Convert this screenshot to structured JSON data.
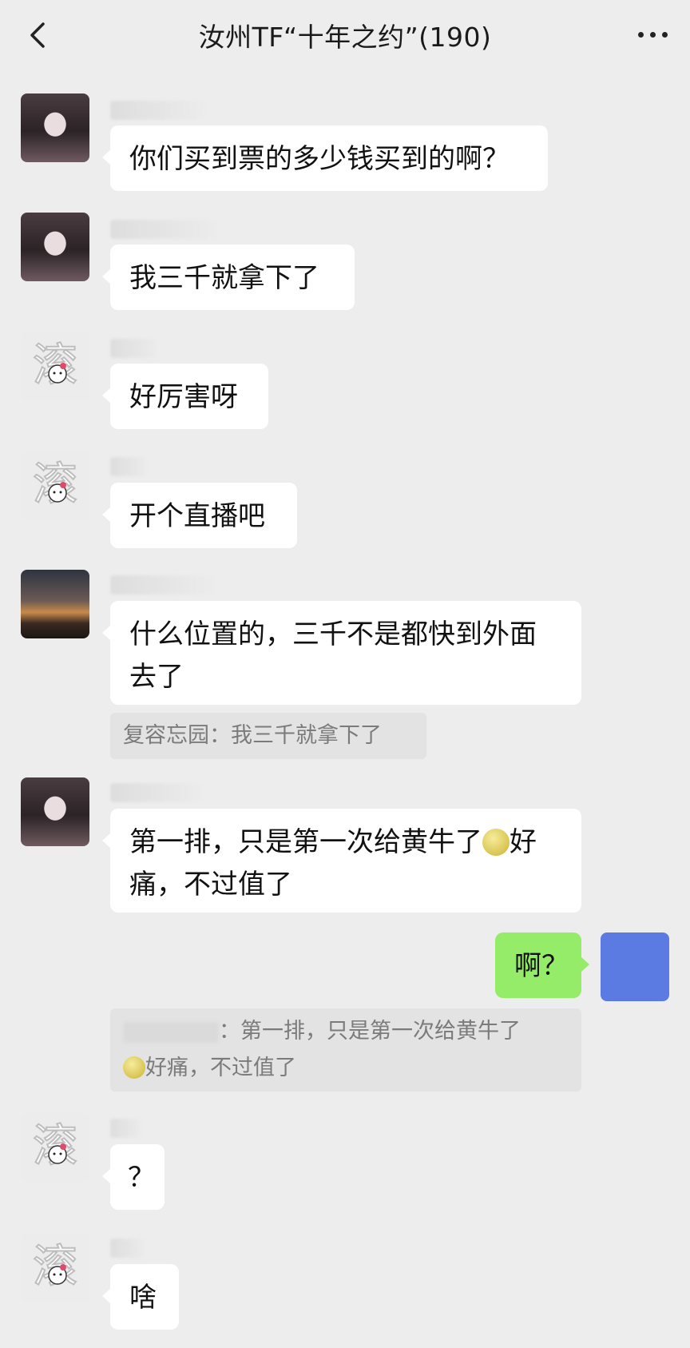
{
  "header": {
    "title": "汝州TF“十年之约”(190)"
  },
  "messages": [
    {
      "id": "m1",
      "text": "你们买到票的多少钱买到的啊？"
    },
    {
      "id": "m2",
      "text": "我三千就拿下了"
    },
    {
      "id": "m3",
      "text": "好厉害呀"
    },
    {
      "id": "m4",
      "text": "开个直播吧"
    },
    {
      "id": "m5",
      "line1": "什么位置的，三千不是都快到外面",
      "line2": "去了"
    },
    {
      "id": "m6",
      "line1a": "第一排，只是第一次给黄牛了",
      "line1b": "好",
      "line2": "痛，不过值了"
    },
    {
      "id": "m7",
      "text": "啊？"
    },
    {
      "id": "m8",
      "text": "？"
    },
    {
      "id": "m9",
      "text": "啥"
    }
  ],
  "quotes": {
    "q1": "复容忘园：我三千就拿下了",
    "q2_line1": "：第一排，只是第一次给黄牛了",
    "q2_line2": "好痛，不过值了"
  },
  "icons": {
    "back": "chevron-left-icon",
    "more": "more-dots-icon",
    "emoji": "awkward-smile-emoji"
  },
  "colors": {
    "background": "#ededed",
    "bubble_other": "#ffffff",
    "bubble_self": "#95ec69",
    "quote_bg": "#e3e3e3",
    "self_avatar": "#5b7be2"
  }
}
